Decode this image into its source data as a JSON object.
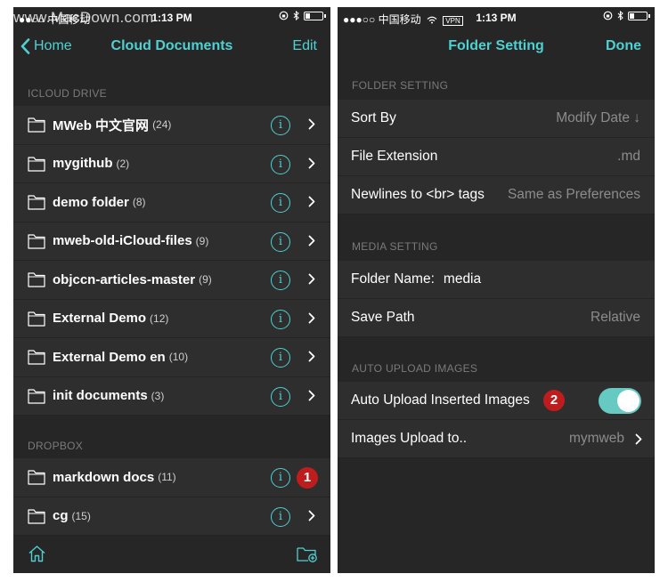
{
  "watermark": "www.MacDown.com",
  "colors": {
    "accent": "#4fd1d1",
    "badge": "#bf1d1d",
    "toggle_on": "#66c9c2"
  },
  "left": {
    "status": {
      "carrier": "●●○○ 中国移动",
      "time": "1:13 PM"
    },
    "nav": {
      "back_label": "Home",
      "title": "Cloud Documents",
      "edit_label": "Edit"
    },
    "icloud_header": "ICLOUD DRIVE",
    "icloud_folders": [
      {
        "name": "MWeb 中文官网",
        "count": "(24)"
      },
      {
        "name": "mygithub",
        "count": "(2)"
      },
      {
        "name": "demo folder",
        "count": "(8)"
      },
      {
        "name": "mweb-old-iCloud-files",
        "count": "(9)"
      },
      {
        "name": "objccn-articles-master",
        "count": "(9)"
      },
      {
        "name": "External Demo",
        "count": "(12)"
      },
      {
        "name": "External Demo en",
        "count": "(10)"
      },
      {
        "name": "init documents",
        "count": "(3)"
      }
    ],
    "dropbox_header": "DROPBOX",
    "dropbox_folders": [
      {
        "name": "markdown docs",
        "count": "(11)"
      },
      {
        "name": "cg",
        "count": "(15)"
      }
    ],
    "badge": "1",
    "icons": {
      "folder": "folder-icon",
      "info": "info-icon",
      "chevron": "chevron-right-icon",
      "home": "home-icon",
      "new_folder": "new-folder-icon"
    }
  },
  "right": {
    "status": {
      "carrier": "●●●○○ 中国移动",
      "vpn": "VPN",
      "time": "1:13 PM"
    },
    "nav": {
      "title": "Folder Setting",
      "done_label": "Done"
    },
    "folder_section": "FOLDER SETTING",
    "sort_by": {
      "label": "Sort By",
      "value": "Modify Date ↓"
    },
    "file_extension": {
      "label": "File Extension",
      "value": ".md"
    },
    "newlines": {
      "label": "Newlines to <br> tags",
      "value": "Same as Preferences"
    },
    "media_section": "MEDIA SETTING",
    "folder_name": {
      "label": "Folder Name:",
      "value": "media"
    },
    "save_path": {
      "label": "Save Path",
      "value": "Relative"
    },
    "upload_section": "AUTO UPLOAD IMAGES",
    "auto_upload": {
      "label": "Auto Upload Inserted Images",
      "on": true
    },
    "upload_to": {
      "label": "Images Upload to..",
      "value": "mymweb"
    },
    "badge": "2"
  }
}
